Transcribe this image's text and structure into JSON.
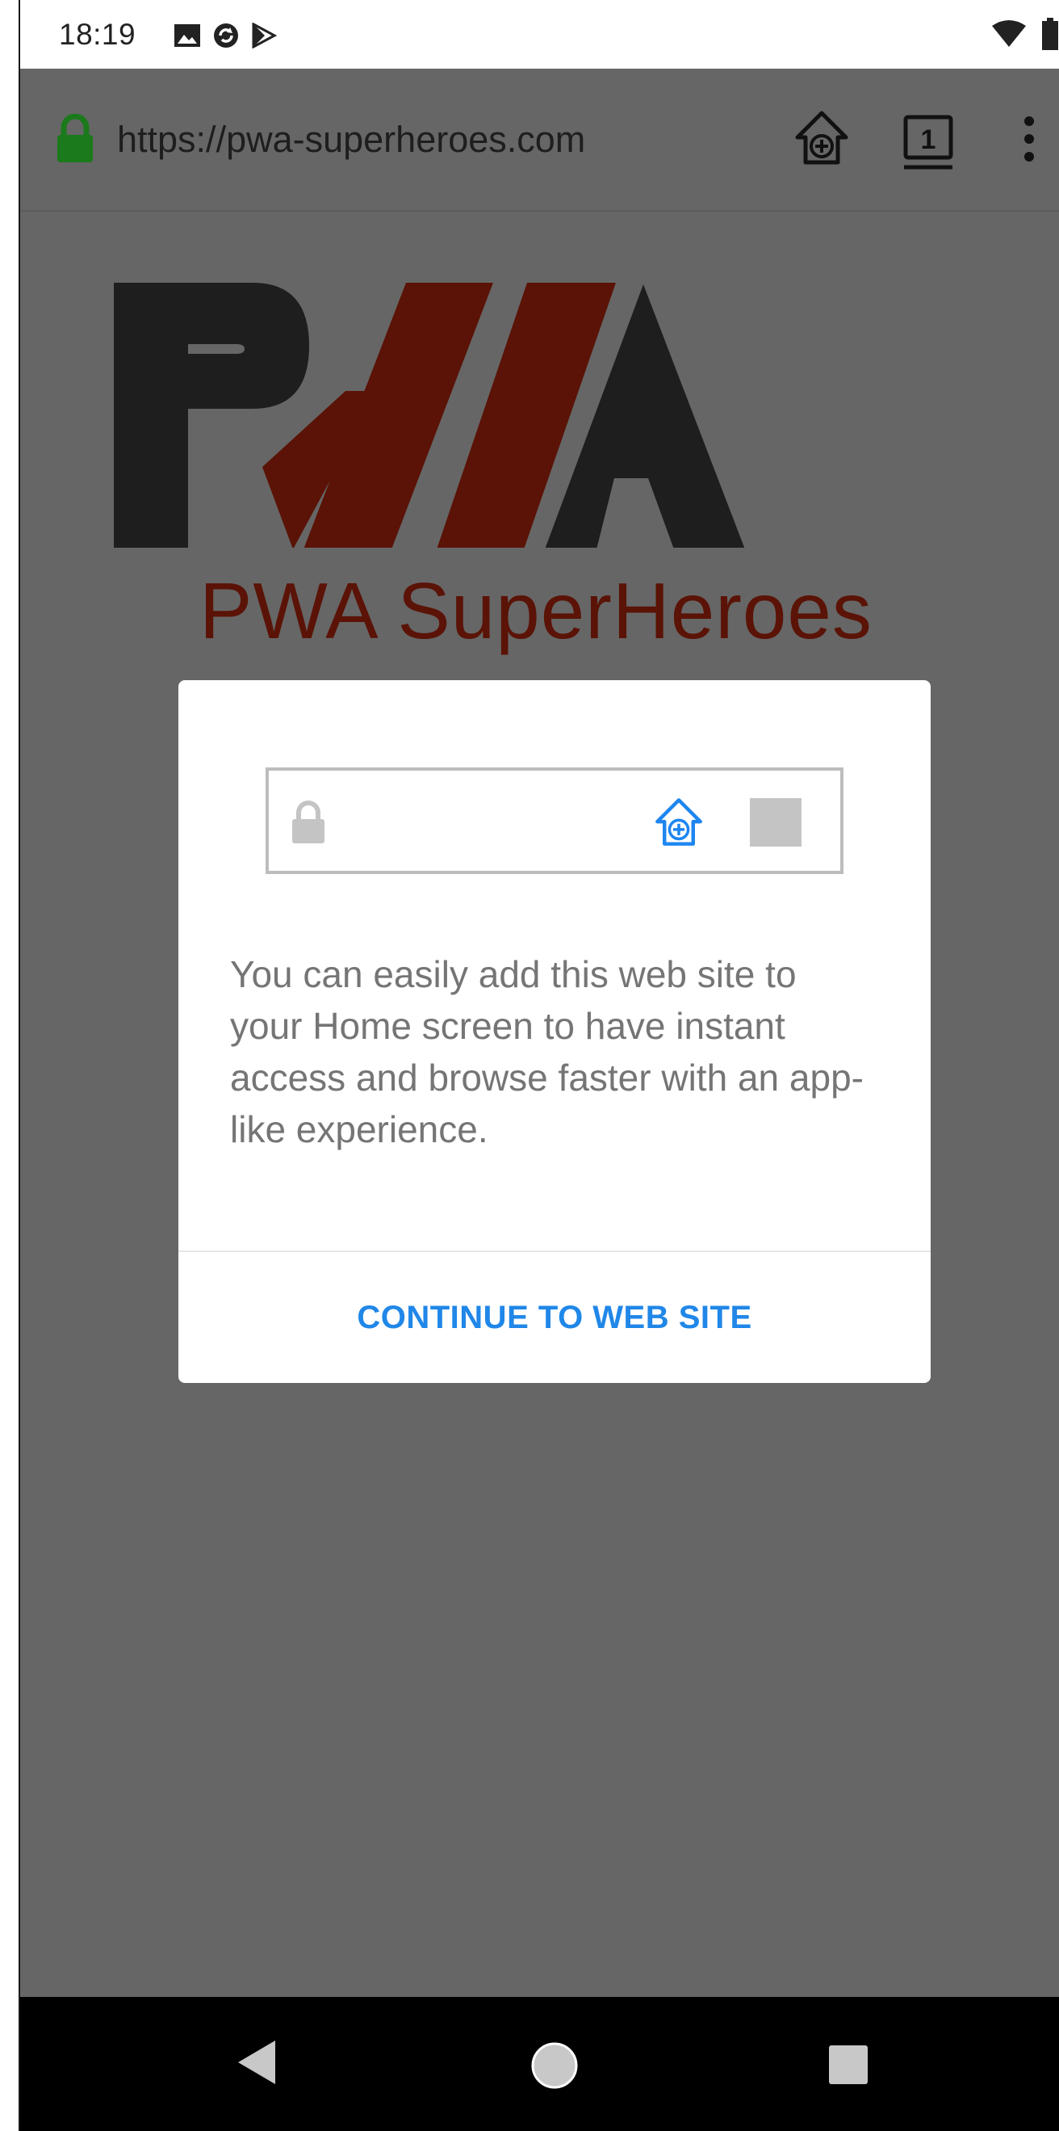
{
  "status_bar": {
    "time": "18:19",
    "left_icons": [
      "image-icon",
      "sync-icon",
      "play-store-icon"
    ],
    "right_icons": [
      "wifi-icon",
      "battery-icon"
    ]
  },
  "browser": {
    "url": "https://pwa-superheroes.com",
    "tab_count": "1",
    "icons": [
      "lock-icon",
      "add-to-home-icon",
      "tabs-icon",
      "overflow-menu-icon"
    ],
    "lock_color": "#1b7a1b"
  },
  "page": {
    "logo_subtitle": "PWA SuperHeroes",
    "logo_colors": {
      "dark": "#1e1e1e",
      "red": "#5a1306"
    }
  },
  "dialog": {
    "message": "You can easily add this web site to your Home screen to have instant access and browse faster with an app-like experience.",
    "button_label": "CONTINUE TO WEB SITE",
    "accent_color": "#2087e8"
  },
  "nav_bar": {
    "icons": [
      "back-icon",
      "home-icon",
      "recents-icon"
    ]
  }
}
